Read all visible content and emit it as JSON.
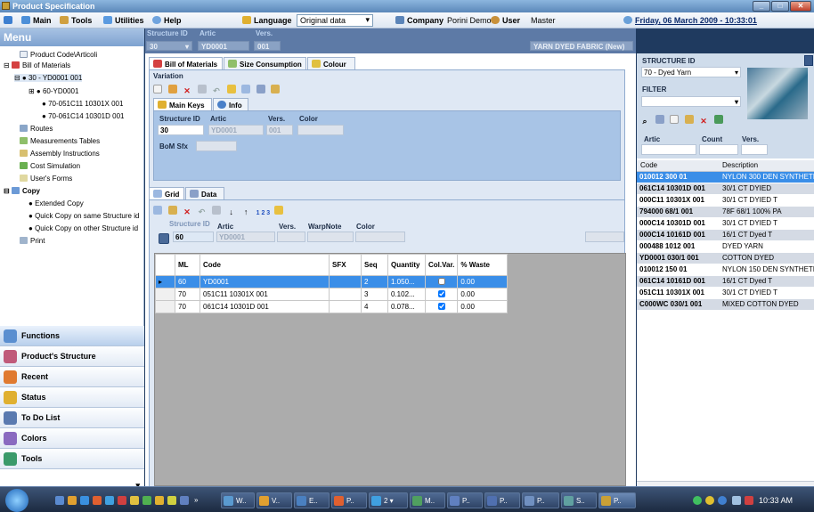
{
  "window": {
    "title": "Product Specification"
  },
  "menubar": {
    "main": "Main",
    "tools": "Tools",
    "utilities": "Utilities",
    "help": "Help",
    "language_label": "Language",
    "language_value": "Original data",
    "company_label": "Company",
    "company_value": "Porini Demo",
    "user_label": "User",
    "user_value": "Master",
    "date": "Friday, 06 March 2009 - 10:33:01"
  },
  "sidebar": {
    "header": "Menu",
    "tree": [
      "Product Code\\Articoli",
      "Bill of Materials",
      "30 - YD0001 001",
      "60-YD0001",
      "70-051C11 10301X 001",
      "70-061C14 10301D 001",
      "Routes",
      "Measurements Tables",
      "Assembly Instructions",
      "Cost Simulation",
      "User's Forms",
      "Copy",
      "Extended Copy",
      "Quick Copy on same Structure id",
      "Quick Copy on other Structure id",
      "Print"
    ],
    "accordion": [
      "Functions",
      "Product's Structure",
      "Recent",
      "Status",
      "To Do List",
      "Colors",
      "Tools"
    ]
  },
  "header": {
    "structure_id_label": "Structure ID",
    "structure_id": "30",
    "artic_label": "Artic",
    "artic": "YD0001",
    "vers_label": "Vers.",
    "vers": "001",
    "description": "YARN DYED FABRIC (New)"
  },
  "tabs": {
    "bill": "Bill of Materials",
    "size": "Size Consumption",
    "colour": "Colour"
  },
  "variation": {
    "title": "Variation",
    "main_keys_tab": "Main Keys",
    "info_tab": "Info",
    "structure_id_label": "Structure ID",
    "artic_label": "Artic",
    "vers_label": "Vers.",
    "color_label": "Color",
    "structure_id": "30",
    "artic": "YD0001",
    "vers": "001",
    "bom_sfx_label": "BoM Sfx"
  },
  "lower": {
    "grid_tab": "Grid",
    "data_tab": "Data",
    "structure_id_label": "Structure ID",
    "artic_label": "Artic",
    "vers_label": "Vers.",
    "warpnote_label": "WarpNote",
    "color_label": "Color",
    "structure_id": "60",
    "artic": "YD0001",
    "sort_icon": "1 2 3"
  },
  "grid": {
    "headers": [
      "ML",
      "Code",
      "SFX",
      "Seq",
      "Quantity",
      "Col.Var.",
      "% Waste"
    ],
    "rows": [
      {
        "ml": "60",
        "code": "YD0001",
        "sfx": "",
        "seq": "2",
        "qty": "1.050...",
        "colvar": false,
        "waste": "0.00"
      },
      {
        "ml": "70",
        "code": "051C11 10301X 001",
        "sfx": "",
        "seq": "3",
        "qty": "0.102...",
        "colvar": true,
        "waste": "0.00"
      },
      {
        "ml": "70",
        "code": "061C14 10301D 001",
        "sfx": "",
        "seq": "4",
        "qty": "0.078...",
        "colvar": true,
        "waste": "0.00"
      }
    ]
  },
  "right": {
    "structure_id_label": "STRUCTURE ID",
    "structure_id_value": "70 - Dyed Yarn",
    "filter_label": "FILTER",
    "artic_label": "Artic",
    "count_label": "Count",
    "vers_label": "Vers.",
    "col_code": "Code",
    "col_desc": "Description",
    "rows": [
      [
        "010012 300  01",
        "NYLON 300 DEN SYNTHETIC"
      ],
      [
        "061C14 10301D 001",
        "30/1 CT DYIED"
      ],
      [
        "000C11 10301X 001",
        "30/1 CT DYIED T"
      ],
      [
        "794000 68/1  001",
        "78F 68/1 100% PA"
      ],
      [
        "000C14 10301D 001",
        "30/1 CT DYIED T"
      ],
      [
        "000C14 10161D 001",
        "16/1 CT Dyed T"
      ],
      [
        "000488 1012  001",
        "DYED YARN"
      ],
      [
        "YD0001 030/1 001",
        "COTTON DYED"
      ],
      [
        "010012 150  01",
        "NYLON 150 DEN SYNTHETIC"
      ],
      [
        "061C14 10161D 001",
        "16/1 CT Dyed T"
      ],
      [
        "051C11 10301X 001",
        "30/1 CT DYIED T"
      ],
      [
        "C000WC 030/1 001",
        "MIXED COTTON DYED"
      ]
    ]
  },
  "taskbar": {
    "items": [
      "W..",
      "V..",
      "E..",
      "P..",
      "2",
      "M..",
      "P..",
      "P..",
      "P..",
      "S..",
      "P.."
    ],
    "clock": "10:33 AM"
  }
}
